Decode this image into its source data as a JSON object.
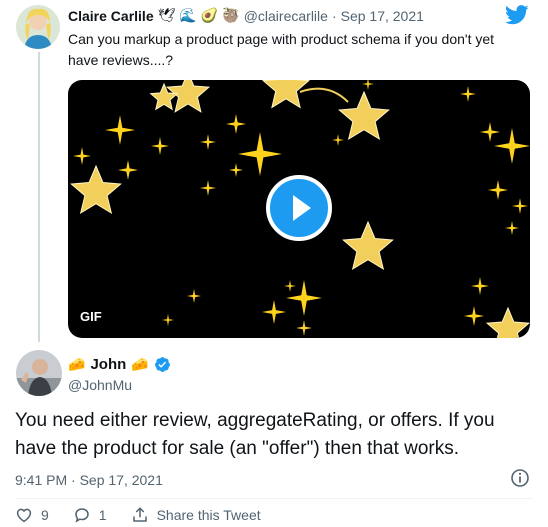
{
  "original_tweet": {
    "display_name": "Claire Carlile",
    "name_emojis": [
      "🕊",
      "🌊",
      "🥑",
      "🦥"
    ],
    "handle": "@clairecarlile",
    "separator": "·",
    "date": "Sep 17, 2021",
    "text": "Can you markup a product page with product schema if you don't yet have reviews....?",
    "media": {
      "badge": "GIF"
    }
  },
  "reply_tweet": {
    "display_name": "John",
    "name_emojis": [
      "🧀",
      "🧀"
    ],
    "handle": "@JohnMu",
    "text": "You need either review, aggregateRating, or offers. If you have the product for sale (an \"offer\") then that works.",
    "timestamp": "9:41 PM · Sep 17, 2021"
  },
  "actions": {
    "like_count": "9",
    "reply_count": "1",
    "share_label": "Share this Tweet"
  },
  "colors": {
    "twitter_blue": "#1d9bf0",
    "muted": "#536471"
  }
}
